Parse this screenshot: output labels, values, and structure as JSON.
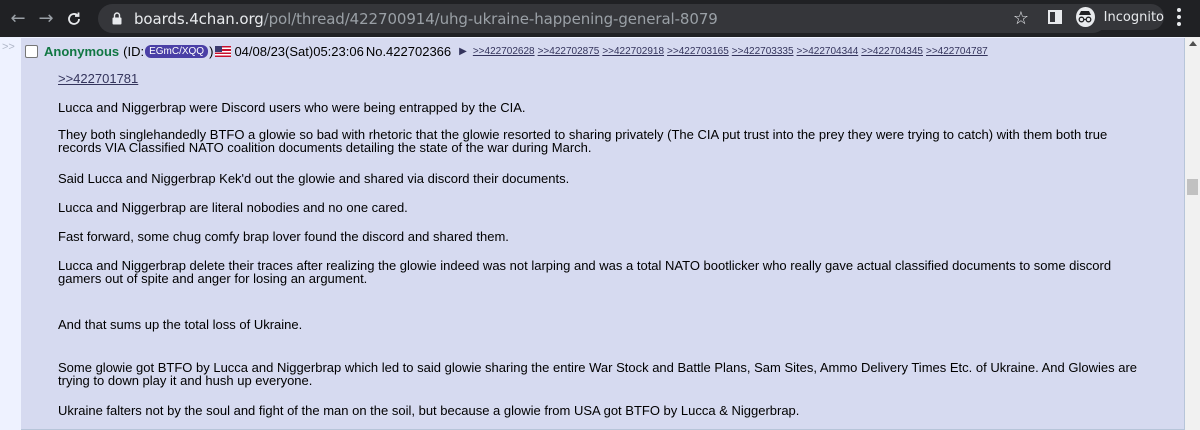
{
  "browser": {
    "url_host": "boards.4chan.org",
    "url_path": "/pol/thread/422700914/uhg-ukraine-happening-general-8079",
    "incognito_label": "Incognito",
    "icons": {
      "back": "arrow-left-icon",
      "forward": "arrow-right-icon",
      "reload": "reload-icon",
      "lock": "lock-icon",
      "bookmark": "star-icon",
      "tabs": "tab-icon",
      "incognito": "incognito-icon",
      "menu": "kebab-menu-icon"
    }
  },
  "post": {
    "side_marker": ">>",
    "name": "Anonymous",
    "id_prefix": "(ID:",
    "id": "EGmC/XQQ",
    "id_suffix": ")",
    "datetime": "04/08/23(Sat)05:23:06",
    "number": "No.422702366",
    "reply_arrow": "▶",
    "backlinks": [
      ">>422702628",
      ">>422702875",
      ">>422702918",
      ">>422703165",
      ">>422703335",
      ">>422704344",
      ">>422704345",
      ">>422704787"
    ],
    "quote": ">>422701781",
    "paragraphs": [
      "Lucca and Niggerbrap were Discord users who were being entrapped by the CIA.",
      "They both singlehandedly BTFO a glowie so bad with rhetoric that the glowie resorted to sharing privately (The CIA put trust into the prey they were trying to catch) with them both true records VIA Classified NATO coalition documents detailing the state of the war during March.",
      "Said Lucca and Niggerbrap Kek'd out the glowie and shared via discord their documents.",
      "Lucca and Niggerbrap are literal nobodies and no one cared.",
      "Fast forward, some chug comfy brap lover found the discord and shared them.",
      "Lucca and Niggerbrap delete their traces after realizing the glowie indeed was not larping and was a total NATO bootlicker who really gave actual classified documents to some discord gamers out of spite and anger for losing an argument.",
      "And that sums up the total loss of Ukraine.",
      "Some glowie got BTFO by Lucca and Niggerbrap which led to said glowie sharing the entire War Stock and Battle Plans, Sam Sites, Ammo Delivery Times Etc. of Ukraine. And Glowies are trying to down play it and hush up everyone.",
      "Ukraine falters not by the soul and fight of the man on the soil, but because a glowie from USA got BTFO by Lucca & Niggerbrap."
    ]
  },
  "colors": {
    "chrome_bg": "#202124",
    "omnibox_bg": "#35363a",
    "post_bg": "#d6daf0",
    "page_bg": "#eef2ff",
    "name": "#117743",
    "id_tag": "#4a3fa6",
    "link": "#34345c"
  }
}
